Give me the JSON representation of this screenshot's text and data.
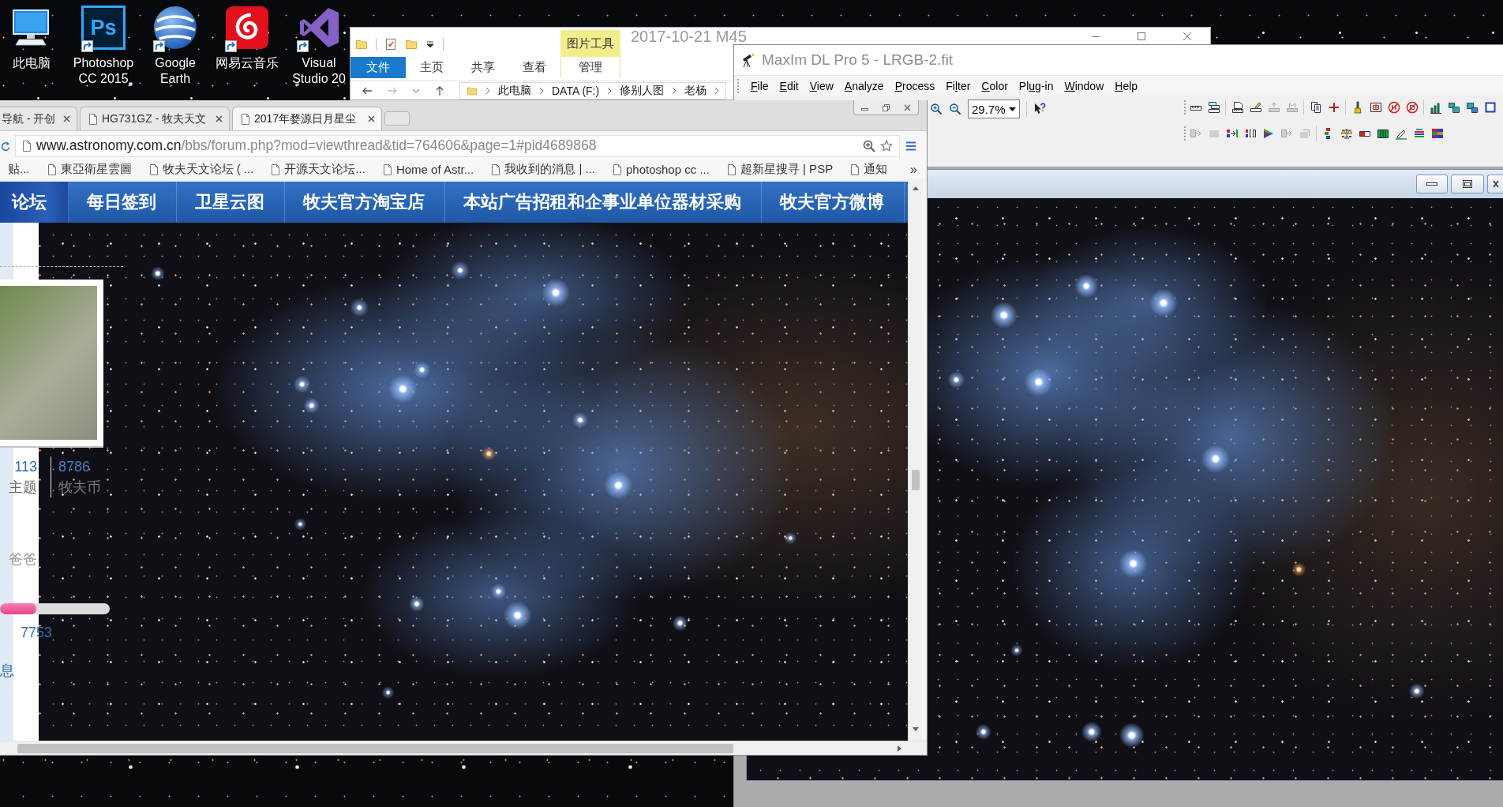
{
  "desktop": {
    "icons": [
      {
        "kind": "computer",
        "label": "此电脑",
        "shortcut": false
      },
      {
        "kind": "photoshop",
        "label": "Photoshop CC 2015",
        "logo_text": "Ps",
        "shortcut": true
      },
      {
        "kind": "globe",
        "label": "Google Earth",
        "shortcut": true
      },
      {
        "kind": "music",
        "label": "网易云音乐",
        "shortcut": true
      },
      {
        "kind": "visual-studio",
        "label": "Visual Studio 20",
        "shortcut": true
      }
    ]
  },
  "explorer": {
    "title": "2017-10-21 M45",
    "context_group": "图片工具",
    "ribbon_tabs": [
      {
        "kind": "file",
        "label": "文件"
      },
      {
        "kind": "tab",
        "label": "主页"
      },
      {
        "kind": "tab",
        "label": "共享"
      },
      {
        "kind": "tab",
        "label": "查看"
      },
      {
        "kind": "context",
        "label": "管理"
      }
    ],
    "breadcrumb": [
      "此电脑",
      "DATA (F:)",
      "修别人图",
      "老杨"
    ]
  },
  "maxim": {
    "title": "MaxIm DL Pro 5 - LRGB-2.fit",
    "menu": [
      {
        "key": "F",
        "rest": "ile"
      },
      {
        "key": "E",
        "rest": "dit"
      },
      {
        "key": "V",
        "rest": "iew"
      },
      {
        "key": "A",
        "rest": "nalyze"
      },
      {
        "key": "P",
        "rest": "rocess"
      },
      {
        "lead": "Fi",
        "key": "l",
        "rest": "ter"
      },
      {
        "key": "C",
        "rest": "olor"
      },
      {
        "lead": "Pl",
        "key": "u",
        "rest": "g-in"
      },
      {
        "key": "W",
        "rest": "indow"
      },
      {
        "key": "H",
        "rest": "elp"
      }
    ],
    "zoom": "29.7%",
    "toolbar_rows": [
      {
        "groups": [
          [
            {
              "kind": "ruler",
              "disabled": false
            },
            {
              "kind": "ruler-stack",
              "disabled": false
            }
          ],
          [
            {
              "kind": "ruler-document",
              "disabled": false
            },
            {
              "kind": "ruler-pen",
              "disabled": false
            },
            {
              "kind": "ruler-arrow",
              "disabled": true
            },
            {
              "kind": "ruler-peak",
              "disabled": true
            }
          ],
          [
            {
              "kind": "pages",
              "disabled": false
            },
            {
              "kind": "plus",
              "disabled": false
            }
          ],
          [
            {
              "kind": "brush",
              "disabled": false
            },
            {
              "kind": "frame-cross",
              "disabled": false
            },
            {
              "kind": "no-entry",
              "disabled": false
            },
            {
              "kind": "circle-square",
              "disabled": false
            }
          ],
          [
            {
              "kind": "bar-chart",
              "disabled": false
            },
            {
              "kind": "squares",
              "disabled": false
            },
            {
              "kind": "squares-offset",
              "disabled": false
            },
            {
              "kind": "square",
              "disabled": false
            }
          ]
        ]
      },
      {
        "groups": [
          [
            {
              "kind": "arrow-box",
              "disabled": true
            },
            {
              "kind": "block",
              "disabled": true
            },
            {
              "kind": "channel-arrows",
              "disabled": false
            },
            {
              "kind": "bracket",
              "disabled": false
            },
            {
              "kind": "play",
              "disabled": false
            },
            {
              "kind": "arrow-box",
              "disabled": true
            },
            {
              "kind": "stack-box",
              "disabled": true
            }
          ],
          [
            {
              "kind": "channel-blocks",
              "disabled": false
            },
            {
              "kind": "balance",
              "disabled": false
            },
            {
              "kind": "bar",
              "disabled": false
            },
            {
              "kind": "columns",
              "disabled": false
            },
            {
              "kind": "pencil",
              "disabled": false
            },
            {
              "kind": "stack",
              "disabled": false
            },
            {
              "kind": "grid",
              "disabled": false
            }
          ]
        ]
      }
    ]
  },
  "browser": {
    "tabs": [
      {
        "title": "导航 - 开创",
        "icon": false,
        "selected": false
      },
      {
        "title": "HG731GZ - 牧夫天文",
        "icon": true,
        "selected": false
      },
      {
        "title": "2017年婺源日月星尘",
        "icon": true,
        "selected": true
      }
    ],
    "address": {
      "host": "www.astronomy.com.cn",
      "path": "/bbs/forum.php?mod=viewthread&tid=764606&page=1#pid4689868"
    },
    "bookmarks": [
      {
        "label": "贴...",
        "icon": false
      },
      {
        "label": "東亞衛星雲圖",
        "icon": true
      },
      {
        "label": "牧夫天文论坛 ( ...",
        "icon": true
      },
      {
        "label": "开源天文论坛...",
        "icon": true
      },
      {
        "label": "Home of Astr...",
        "icon": true
      },
      {
        "label": "我收到的消息 | ...",
        "icon": true
      },
      {
        "label": "photoshop cc ...",
        "icon": true
      },
      {
        "label": "超新星搜寻 | PSP",
        "icon": true
      },
      {
        "label": "通知",
        "icon": true
      }
    ],
    "bookmarks_more": "»",
    "nav": [
      {
        "label": "论坛",
        "selected": true
      },
      {
        "label": "每日签到",
        "selected": false
      },
      {
        "label": "卫星云图",
        "selected": false
      },
      {
        "label": "牧夫官方淘宝店",
        "selected": false
      },
      {
        "label": "本站广告招租和企事业单位器材采购",
        "selected": false
      },
      {
        "label": "牧夫官方微博",
        "selected": false
      }
    ],
    "profile": {
      "stats": [
        {
          "value": "113",
          "label": "主题"
        },
        {
          "value": "8786",
          "label": "牧夫币"
        }
      ],
      "name": "爸爸",
      "progress": {
        "level": 0.33
      },
      "credits": "7753",
      "link": "息"
    }
  }
}
